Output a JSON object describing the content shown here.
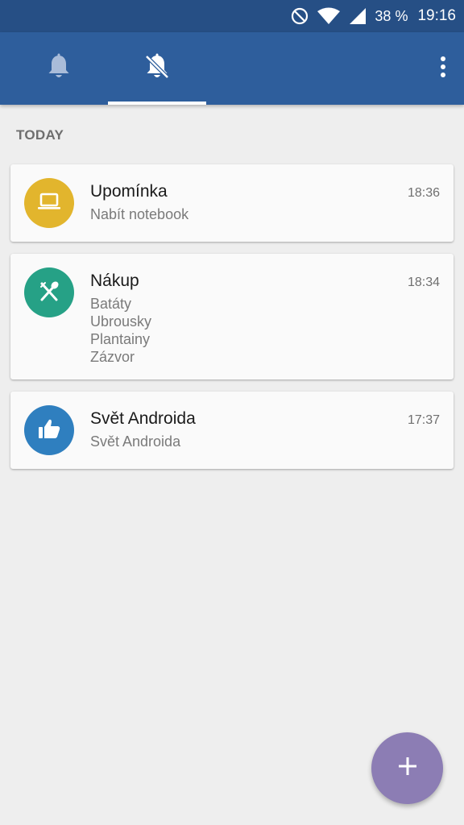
{
  "status_bar": {
    "battery": "38 %",
    "time": "19:16",
    "icons": [
      "do-not-disturb-icon",
      "wifi-icon",
      "signal-icon"
    ]
  },
  "app_bar": {
    "tabs": [
      {
        "icon": "bell-icon",
        "selected": false
      },
      {
        "icon": "bell-off-icon",
        "selected": true
      }
    ],
    "menu_icon": "more-vert-icon",
    "color": "#2e5e9c",
    "status_color": "#264f85"
  },
  "section": {
    "header": "TODAY"
  },
  "notes": [
    {
      "title": "Upomínka",
      "time": "18:36",
      "lines": [
        "Nabít notebook"
      ],
      "icon": "laptop-icon",
      "color": "#e2b52d"
    },
    {
      "title": "Nákup",
      "time": "18:34",
      "lines": [
        "Batáty",
        "Ubrousky",
        "Plantainy",
        "Zázvor"
      ],
      "icon": "fork-spoon-icon",
      "color": "#26a186"
    },
    {
      "title": "Svět Androida",
      "time": "17:37",
      "lines": [
        "Svět Androida"
      ],
      "icon": "thumb-up-icon",
      "color": "#2f7fbf"
    }
  ],
  "fab": {
    "icon": "plus-icon",
    "color": "#8c7db4"
  }
}
